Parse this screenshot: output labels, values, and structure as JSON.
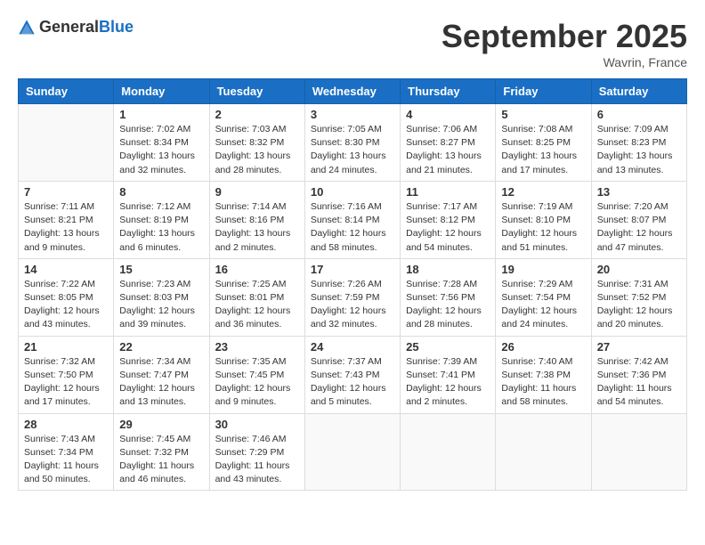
{
  "header": {
    "logo_general": "General",
    "logo_blue": "Blue",
    "month_year": "September 2025",
    "location": "Wavrin, France"
  },
  "days_of_week": [
    "Sunday",
    "Monday",
    "Tuesday",
    "Wednesday",
    "Thursday",
    "Friday",
    "Saturday"
  ],
  "weeks": [
    [
      {
        "day": "",
        "info": ""
      },
      {
        "day": "1",
        "info": "Sunrise: 7:02 AM\nSunset: 8:34 PM\nDaylight: 13 hours and 32 minutes."
      },
      {
        "day": "2",
        "info": "Sunrise: 7:03 AM\nSunset: 8:32 PM\nDaylight: 13 hours and 28 minutes."
      },
      {
        "day": "3",
        "info": "Sunrise: 7:05 AM\nSunset: 8:30 PM\nDaylight: 13 hours and 24 minutes."
      },
      {
        "day": "4",
        "info": "Sunrise: 7:06 AM\nSunset: 8:27 PM\nDaylight: 13 hours and 21 minutes."
      },
      {
        "day": "5",
        "info": "Sunrise: 7:08 AM\nSunset: 8:25 PM\nDaylight: 13 hours and 17 minutes."
      },
      {
        "day": "6",
        "info": "Sunrise: 7:09 AM\nSunset: 8:23 PM\nDaylight: 13 hours and 13 minutes."
      }
    ],
    [
      {
        "day": "7",
        "info": "Sunrise: 7:11 AM\nSunset: 8:21 PM\nDaylight: 13 hours and 9 minutes."
      },
      {
        "day": "8",
        "info": "Sunrise: 7:12 AM\nSunset: 8:19 PM\nDaylight: 13 hours and 6 minutes."
      },
      {
        "day": "9",
        "info": "Sunrise: 7:14 AM\nSunset: 8:16 PM\nDaylight: 13 hours and 2 minutes."
      },
      {
        "day": "10",
        "info": "Sunrise: 7:16 AM\nSunset: 8:14 PM\nDaylight: 12 hours and 58 minutes."
      },
      {
        "day": "11",
        "info": "Sunrise: 7:17 AM\nSunset: 8:12 PM\nDaylight: 12 hours and 54 minutes."
      },
      {
        "day": "12",
        "info": "Sunrise: 7:19 AM\nSunset: 8:10 PM\nDaylight: 12 hours and 51 minutes."
      },
      {
        "day": "13",
        "info": "Sunrise: 7:20 AM\nSunset: 8:07 PM\nDaylight: 12 hours and 47 minutes."
      }
    ],
    [
      {
        "day": "14",
        "info": "Sunrise: 7:22 AM\nSunset: 8:05 PM\nDaylight: 12 hours and 43 minutes."
      },
      {
        "day": "15",
        "info": "Sunrise: 7:23 AM\nSunset: 8:03 PM\nDaylight: 12 hours and 39 minutes."
      },
      {
        "day": "16",
        "info": "Sunrise: 7:25 AM\nSunset: 8:01 PM\nDaylight: 12 hours and 36 minutes."
      },
      {
        "day": "17",
        "info": "Sunrise: 7:26 AM\nSunset: 7:59 PM\nDaylight: 12 hours and 32 minutes."
      },
      {
        "day": "18",
        "info": "Sunrise: 7:28 AM\nSunset: 7:56 PM\nDaylight: 12 hours and 28 minutes."
      },
      {
        "day": "19",
        "info": "Sunrise: 7:29 AM\nSunset: 7:54 PM\nDaylight: 12 hours and 24 minutes."
      },
      {
        "day": "20",
        "info": "Sunrise: 7:31 AM\nSunset: 7:52 PM\nDaylight: 12 hours and 20 minutes."
      }
    ],
    [
      {
        "day": "21",
        "info": "Sunrise: 7:32 AM\nSunset: 7:50 PM\nDaylight: 12 hours and 17 minutes."
      },
      {
        "day": "22",
        "info": "Sunrise: 7:34 AM\nSunset: 7:47 PM\nDaylight: 12 hours and 13 minutes."
      },
      {
        "day": "23",
        "info": "Sunrise: 7:35 AM\nSunset: 7:45 PM\nDaylight: 12 hours and 9 minutes."
      },
      {
        "day": "24",
        "info": "Sunrise: 7:37 AM\nSunset: 7:43 PM\nDaylight: 12 hours and 5 minutes."
      },
      {
        "day": "25",
        "info": "Sunrise: 7:39 AM\nSunset: 7:41 PM\nDaylight: 12 hours and 2 minutes."
      },
      {
        "day": "26",
        "info": "Sunrise: 7:40 AM\nSunset: 7:38 PM\nDaylight: 11 hours and 58 minutes."
      },
      {
        "day": "27",
        "info": "Sunrise: 7:42 AM\nSunset: 7:36 PM\nDaylight: 11 hours and 54 minutes."
      }
    ],
    [
      {
        "day": "28",
        "info": "Sunrise: 7:43 AM\nSunset: 7:34 PM\nDaylight: 11 hours and 50 minutes."
      },
      {
        "day": "29",
        "info": "Sunrise: 7:45 AM\nSunset: 7:32 PM\nDaylight: 11 hours and 46 minutes."
      },
      {
        "day": "30",
        "info": "Sunrise: 7:46 AM\nSunset: 7:29 PM\nDaylight: 11 hours and 43 minutes."
      },
      {
        "day": "",
        "info": ""
      },
      {
        "day": "",
        "info": ""
      },
      {
        "day": "",
        "info": ""
      },
      {
        "day": "",
        "info": ""
      }
    ]
  ]
}
